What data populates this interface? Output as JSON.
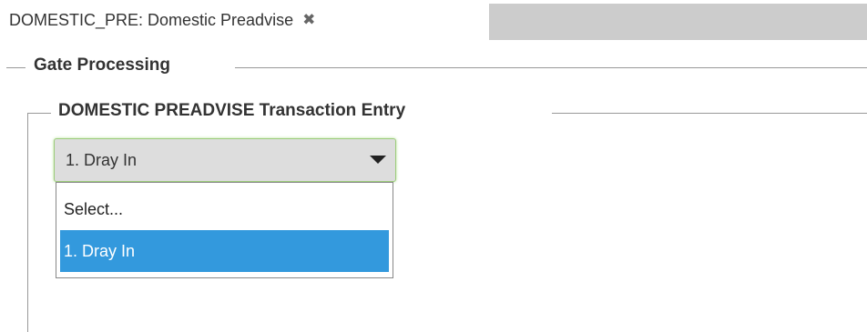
{
  "tab": {
    "title": "DOMESTIC_PRE: Domestic Preadvise",
    "close_icon": "close-icon"
  },
  "gate_processing": {
    "legend": "Gate Processing"
  },
  "transaction_entry": {
    "legend": "DOMESTIC PREADVISE Transaction Entry",
    "select": {
      "selected": "1. Dray In",
      "options": [
        "Select...",
        "1. Dray In"
      ],
      "highlighted_index": 1
    }
  },
  "colors": {
    "highlight": "#3399dd",
    "focus_border": "#9ccc7b",
    "tab_filler": "#cccccc"
  }
}
